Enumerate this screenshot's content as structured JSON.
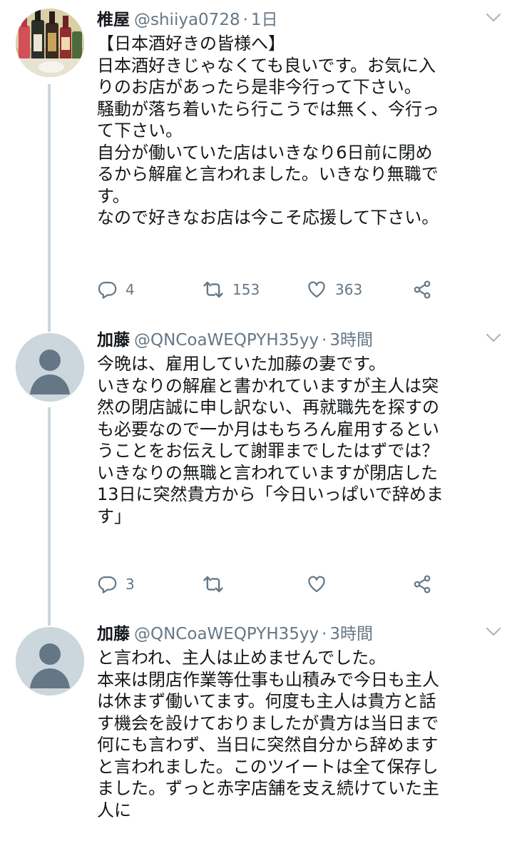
{
  "tweets": [
    {
      "name": "椎屋",
      "handle": "@shiiya0728",
      "time": "1日",
      "lines": [
        "【日本酒好きの皆様へ】",
        "日本酒好きじゃなくても良いです。お気に入",
        "りのお店があったら是非今行って下さい。",
        "騒動が落ち着いたら行こうでは無く、今行っ",
        "て下さい。",
        "自分が働いていた店はいきなり6日前に閉め",
        "るから解雇と言われました。いきなり無職で",
        "す。",
        "なので好きなお店は今こそ応援して下さい。"
      ],
      "replies": "4",
      "retweets": "153",
      "likes": "363"
    },
    {
      "name": "加藤",
      "handle": "@QNCoaWEQPYH35yy",
      "time": "3時間",
      "lines": [
        "今晩は、雇用していた加藤の妻です。",
        "いきなりの解雇と書かれていますが主人は突",
        "然の閉店誠に申し訳ない、再就職先を探すの",
        "も必要なので一か月はもちろん雇用するとい",
        "うことをお伝えして謝罪までしたはずでは？",
        "いきなりの無職と言われていますが閉店した",
        "13日に突然貴方から「今日いっぱいで辞めま",
        "す」"
      ],
      "replies": "3",
      "retweets": "",
      "likes": ""
    },
    {
      "name": "加藤",
      "handle": "@QNCoaWEQPYH35yy",
      "time": "3時間",
      "lines": [
        "と言われ、主人は止めませんでした。",
        "本来は閉店作業等仕事も山積みで今日も主人",
        "は休まず働いてます。何度も主人は貴方と話",
        "す機会を設けておりましたが貴方は当日まで",
        "何にも言わず、当日に突然自分から辞めます",
        "と言われました。このツイートは全て保存し",
        "ました。ずっと赤字店舗を支え続けていた主",
        "人に"
      ]
    }
  ],
  "icons": {
    "reply": "reply-icon",
    "retweet": "retweet-icon",
    "like": "heart-icon",
    "share": "share-icon",
    "more": "chevron-down-icon",
    "default_avatar": "default-avatar-icon"
  },
  "colors": {
    "text": "#14171a",
    "secondary": "#657786",
    "thread_line": "#ccd6dd",
    "avatar_bg": "#ccd6dd",
    "avatar_figure": "#657786"
  }
}
